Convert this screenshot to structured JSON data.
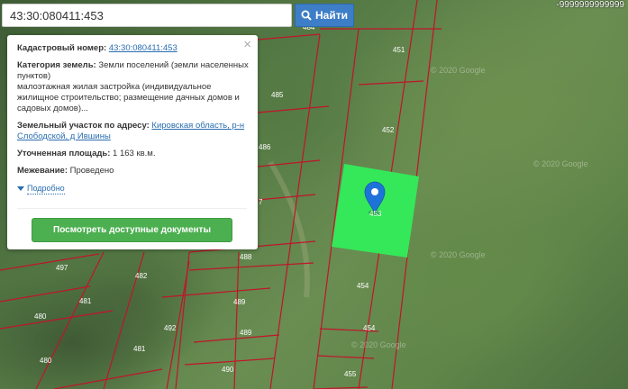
{
  "search": {
    "value": "43:30:080411:453",
    "button_label": "Найти"
  },
  "coords_readout": "-9999999999999",
  "popup": {
    "cadastral_label": "Кадастровый номер:",
    "cadastral_value": "43:30:080411:453",
    "category_label": "Категория земель:",
    "category_value": "Земли поселений (земли населенных пунктов)",
    "usage_text": "малоэтажная жилая застройка (индивидуальное жилищное строительство; размещение дачных домов и садовых домов)...",
    "address_label": "Земельный участок по адресу:",
    "address_value": "Кировская область, р-н Слободской, д Ившины",
    "area_label": "Уточненная площадь:",
    "area_value": "1 163 кв.м.",
    "survey_label": "Межевание:",
    "survey_value": "Проведено",
    "more_label": "Подробно",
    "docs_button": "Посмотреть доступные документы"
  },
  "attribution": "© 2020 Google",
  "map_labels": {
    "p484": "484",
    "p451": "451",
    "p485": "485",
    "p452": "452",
    "p486": "486",
    "p487": "7",
    "p488": "488",
    "p453": "453",
    "p454a": "454",
    "p454b": "454",
    "p455": "455",
    "p497": "497",
    "p482": "482",
    "p481": "481",
    "p480a": "480",
    "p480b": "480",
    "p489a": "489",
    "p489b": "489",
    "p492": "492",
    "p490": "490"
  },
  "colors": {
    "highlight": "#34e85a",
    "boundary": "#c0152a",
    "marker": "#1e73d8",
    "button_green": "#4caf50",
    "search_blue": "#3d7ec7"
  },
  "icons": {
    "search": "search-icon",
    "close": "close-icon",
    "marker": "map-marker-icon",
    "expand": "triangle-down-icon"
  }
}
